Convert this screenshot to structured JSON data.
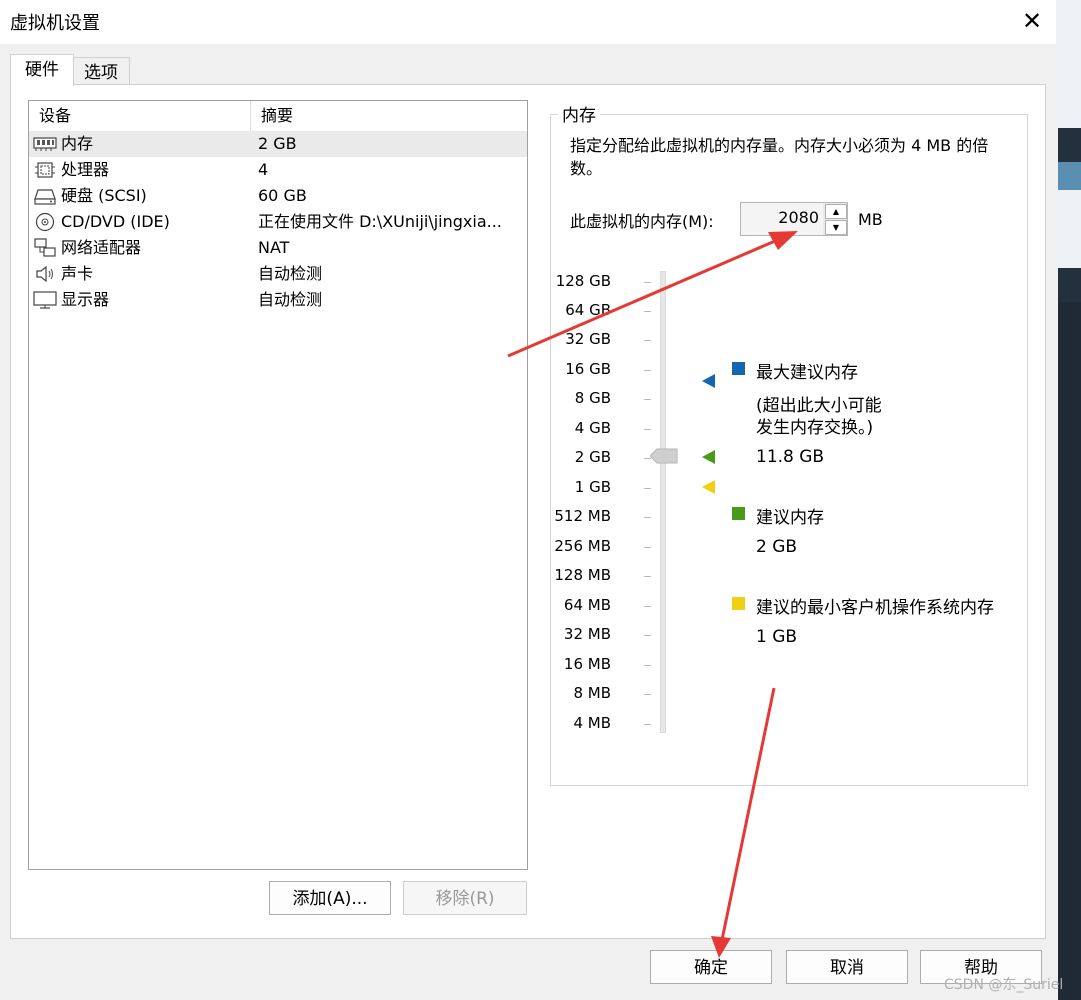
{
  "window": {
    "title": "虚拟机设置",
    "close_symbol": "✕"
  },
  "tabs": [
    {
      "label": "硬件",
      "active": true
    },
    {
      "label": "选项",
      "active": false
    }
  ],
  "device_list": {
    "columns": [
      "设备",
      "摘要"
    ],
    "rows": [
      {
        "icon": "memory-icon",
        "device": "内存",
        "summary": "2 GB",
        "selected": true
      },
      {
        "icon": "processor-icon",
        "device": "处理器",
        "summary": "4"
      },
      {
        "icon": "hard-disk-icon",
        "device": "硬盘 (SCSI)",
        "summary": "60 GB"
      },
      {
        "icon": "cd-dvd-icon",
        "device": "CD/DVD (IDE)",
        "summary": "正在使用文件 D:\\XUniji\\jingxia..."
      },
      {
        "icon": "network-adapter-icon",
        "device": "网络适配器",
        "summary": "NAT"
      },
      {
        "icon": "sound-card-icon",
        "device": "声卡",
        "summary": "自动检测"
      },
      {
        "icon": "display-icon",
        "device": "显示器",
        "summary": "自动检测"
      }
    ]
  },
  "list_buttons": {
    "add": "添加(A)...",
    "remove": "移除(R)"
  },
  "memory": {
    "group_title": "内存",
    "description": "指定分配给此虚拟机的内存量。内存大小必须为 4 MB 的倍数。",
    "field_label": "此虚拟机的内存(M):",
    "value": "2080",
    "unit": "MB",
    "scale_labels": [
      "128 GB",
      "64 GB",
      "32 GB",
      "16 GB",
      "8 GB",
      "4 GB",
      "2 GB",
      "1 GB",
      "512 MB",
      "256 MB",
      "128 MB",
      "64 MB",
      "32 MB",
      "16 MB",
      "8 MB",
      "4 MB"
    ],
    "legend": {
      "max_title": "最大建议内存",
      "max_note_line1": "(超出此大小可能",
      "max_note_line2": "发生内存交换。)",
      "max_value": "11.8 GB",
      "rec_title": "建议内存",
      "rec_value": "2 GB",
      "min_title": "建议的最小客户机操作系统内存",
      "min_value": "1 GB"
    },
    "colors": {
      "max": "#1565b0",
      "recommended": "#4a9a1a",
      "min": "#f0d010"
    }
  },
  "dialog_buttons": {
    "ok": "确定",
    "cancel": "取消",
    "help": "帮助"
  },
  "watermark": "CSDN @东_Suriel"
}
